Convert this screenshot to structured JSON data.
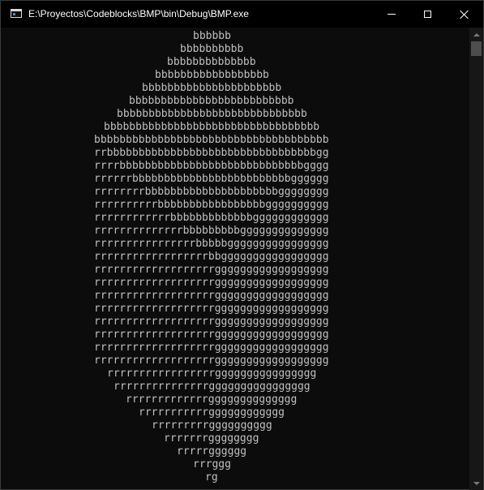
{
  "window": {
    "title": "E:\\Proyectos\\Codeblocks\\BMP\\bin\\Debug\\BMP.exe",
    "controls": {
      "minimize_icon": "minimize-icon",
      "maximize_icon": "maximize-icon",
      "close_icon": "close-icon"
    }
  },
  "console": {
    "text_color": "#c0c0c0",
    "background": "#0c0c0c",
    "lines": [
      "bbbbbb",
      "bbbbbbbbbb",
      "bbbbbbbbbbbbbb",
      "bbbbbbbbbbbbbbbbbb",
      "bbbbbbbbbbbbbbbbbbbbbb",
      "bbbbbbbbbbbbbbbbbbbbbbbbbb",
      "bbbbbbbbbbbbbbbbbbbbbbbbbbbbbb",
      "bbbbbbbbbbbbbbbbbbbbbbbbbbbbbbbbbb",
      "bbbbbbbbbbbbbbbbbbbbbbbbbbbbbbbbbbbbb",
      "rrbbbbbbbbbbbbbbbbbbbbbbbbbbbbbbbbbgg",
      "rrrrbbbbbbbbbbbbbbbbbbbbbbbbbbbbbgggg",
      "rrrrrrbbbbbbbbbbbbbbbbbbbbbbbbbgggggg",
      "rrrrrrrrbbbbbbbbbbbbbbbbbbbbbgggggggg",
      "rrrrrrrrrrbbbbbbbbbbbbbbbbbgggggggggg",
      "rrrrrrrrrrrrbbbbbbbbbbbbbgggggggggggg",
      "rrrrrrrrrrrrrrbbbbbbbbbgggggggggggggg",
      "rrrrrrrrrrrrrrrrbbbbbgggggggggggggggg",
      "rrrrrrrrrrrrrrrrrrbbggggggggggggggggg",
      "rrrrrrrrrrrrrrrrrrrgggggggggggggggggg",
      "rrrrrrrrrrrrrrrrrrrgggggggggggggggggg",
      "rrrrrrrrrrrrrrrrrrrgggggggggggggggggg",
      "rrrrrrrrrrrrrrrrrrrgggggggggggggggggg",
      "rrrrrrrrrrrrrrrrrrrgggggggggggggggggg",
      "rrrrrrrrrrrrrrrrrrrgggggggggggggggggg",
      "rrrrrrrrrrrrrrrrrrrgggggggggggggggggg",
      "rrrrrrrrrrrrrrrrrrrgggggggggggggggggg",
      "rrrrrrrrrrrrrrrrrgggggggggggggggg",
      "rrrrrrrrrrrrrrrgggggggggggggggg",
      "rrrrrrrrrrrrrgggggggggggggg",
      "rrrrrrrrrrrgggggggggggg",
      "rrrrrrrrrgggggggggg",
      "rrrrrrrgggggggg",
      "rrrrrgggggg",
      "rrrggg",
      "rg"
    ]
  },
  "scrollbar": {
    "up_icon": "scroll-up-arrow-icon",
    "down_icon": "scroll-down-arrow-icon"
  }
}
